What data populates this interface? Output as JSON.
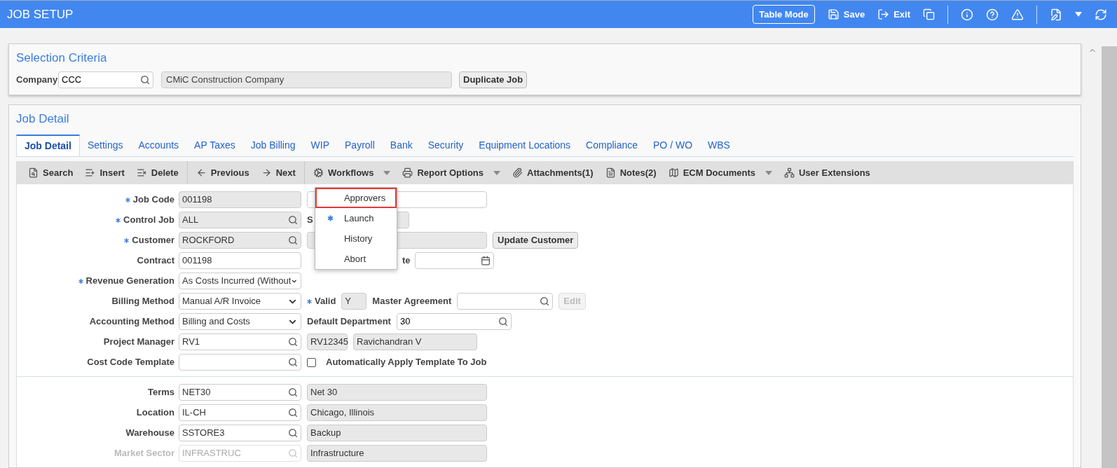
{
  "header": {
    "title": "JOB SETUP",
    "actions": [
      {
        "label": "Table Mode",
        "kind": "outlined"
      },
      {
        "label": "Save",
        "kind": "icon_text"
      },
      {
        "label": "Exit",
        "kind": "icon_text"
      }
    ]
  },
  "selection_criteria": {
    "title": "Selection Criteria",
    "company_label": "Company",
    "company_code": "CCC",
    "company_name": "CMiC Construction Company",
    "button": "Duplicate Job"
  },
  "job_detail": {
    "title": "Job Detail",
    "tabs": [
      {
        "label": "Job Detail",
        "selected": true
      },
      {
        "label": "Settings",
        "selected": false
      },
      {
        "label": "Accounts",
        "selected": false
      },
      {
        "label": "AP Taxes",
        "selected": false
      },
      {
        "label": "Job Billing",
        "selected": false
      },
      {
        "label": "WIP",
        "selected": false
      },
      {
        "label": "Payroll",
        "selected": false
      },
      {
        "label": "Bank",
        "selected": false
      },
      {
        "label": "Security",
        "selected": false
      },
      {
        "label": "Equipment Locations",
        "selected": false
      },
      {
        "label": "Compliance",
        "selected": false
      },
      {
        "label": "PO / WO",
        "selected": false
      },
      {
        "label": "WBS",
        "selected": false
      }
    ],
    "toolbar": [
      {
        "label": "Search",
        "caret": false,
        "group_end": false
      },
      {
        "label": "Insert",
        "caret": false,
        "group_end": false
      },
      {
        "label": "Delete",
        "caret": false,
        "group_end": true
      },
      {
        "label": "Previous",
        "caret": false,
        "group_end": false
      },
      {
        "label": "Next",
        "caret": false,
        "group_end": true
      },
      {
        "label": "Workflows",
        "caret": true,
        "group_end": false,
        "menu": [
          {
            "label": "Approvers",
            "selected": true,
            "marked": false
          },
          {
            "label": "Launch",
            "selected": false,
            "marked": true
          },
          {
            "label": "History",
            "selected": false,
            "marked": false
          },
          {
            "label": "Abort",
            "selected": false,
            "marked": false
          }
        ]
      },
      {
        "label": "Report Options",
        "caret": true,
        "group_end": false
      },
      {
        "label": "Attachments(1)",
        "caret": false,
        "group_end": false
      },
      {
        "label": "Notes(2)",
        "caret": false,
        "group_end": false
      },
      {
        "label": "ECM Documents",
        "caret": true,
        "group_end": false
      },
      {
        "label": "User Extensions",
        "caret": false,
        "group_end": false
      }
    ],
    "sections": [
      [
        {
          "label": "Job Code",
          "required": true,
          "disabled": false,
          "field": {
            "kind": "readonly",
            "value": "001198"
          },
          "extras": [
            {
              "kind": "text"
            }
          ]
        },
        {
          "label": "Control Job",
          "required": true,
          "disabled": false,
          "field": {
            "kind": "readonly_lookup",
            "value": "ALL"
          },
          "extras": [
            {
              "kind": "readonly",
              "label": "S"
            }
          ]
        },
        {
          "label": "Customer",
          "required": true,
          "disabled": false,
          "field": {
            "kind": "readonly_lookup",
            "value": "ROCKFORD"
          },
          "extras": [
            {
              "kind": "readonly"
            },
            {
              "kind": "button",
              "label": "Update Customer",
              "disabled": false
            }
          ]
        },
        {
          "label": "Contract",
          "required": false,
          "disabled": false,
          "field": {
            "kind": "text",
            "value": "001198"
          },
          "extras": [
            {
              "kind": "date",
              "label": "te"
            }
          ]
        },
        {
          "label": "Revenue Generation",
          "required": true,
          "disabled": false,
          "field": {
            "kind": "select",
            "value": "As Costs Incurred (Without"
          }
        },
        {
          "label": "Billing Method",
          "required": false,
          "disabled": false,
          "field": {
            "kind": "select",
            "value": "Manual A/R Invoice"
          },
          "extras": [
            {
              "kind": "label",
              "label": "Valid",
              "required": true
            },
            {
              "kind": "readonly",
              "value": "Y"
            },
            {
              "kind": "label",
              "label": "Master Agreement",
              "required": false
            },
            {
              "kind": "lookup"
            },
            {
              "kind": "button",
              "label": "Edit",
              "disabled": true
            }
          ]
        },
        {
          "label": "Accounting Method",
          "required": false,
          "disabled": false,
          "field": {
            "kind": "select",
            "value": "Billing and Costs"
          },
          "extras": [
            {
              "kind": "label",
              "label": "Default Department",
              "required": false
            },
            {
              "kind": "lookup",
              "value": "30"
            }
          ]
        },
        {
          "label": "Project Manager",
          "required": false,
          "disabled": false,
          "field": {
            "kind": "lookup",
            "value": "RV1"
          },
          "extras": [
            {
              "kind": "readonly",
              "value": "RV12345"
            },
            {
              "kind": "readonly",
              "value": "Ravichandran V"
            }
          ]
        },
        {
          "label": "Cost Code Template",
          "required": false,
          "disabled": false,
          "field": {
            "kind": "lookup"
          },
          "extras": [
            {
              "kind": "checkbox",
              "label": "Automatically Apply Template To Job",
              "checked": false
            }
          ]
        }
      ],
      [
        {
          "label": "Terms",
          "required": false,
          "disabled": false,
          "field": {
            "kind": "lookup",
            "value": "NET30"
          },
          "extras": [
            {
              "kind": "readonly",
              "value": "Net 30"
            }
          ]
        },
        {
          "label": "Location",
          "required": false,
          "disabled": false,
          "field": {
            "kind": "lookup",
            "value": "IL-CH"
          },
          "extras": [
            {
              "kind": "readonly",
              "value": "Chicago, Illinois"
            }
          ]
        },
        {
          "label": "Warehouse",
          "required": false,
          "disabled": false,
          "field": {
            "kind": "lookup",
            "value": "SSTORE3"
          },
          "extras": [
            {
              "kind": "readonly",
              "value": "Backup"
            }
          ]
        },
        {
          "label": "Market Sector",
          "required": false,
          "disabled": true,
          "field": {
            "kind": "lookup",
            "value": "INFRASTRUC"
          },
          "extras": [
            {
              "kind": "readonly",
              "value": "Infrastructure"
            }
          ]
        }
      ]
    ]
  }
}
